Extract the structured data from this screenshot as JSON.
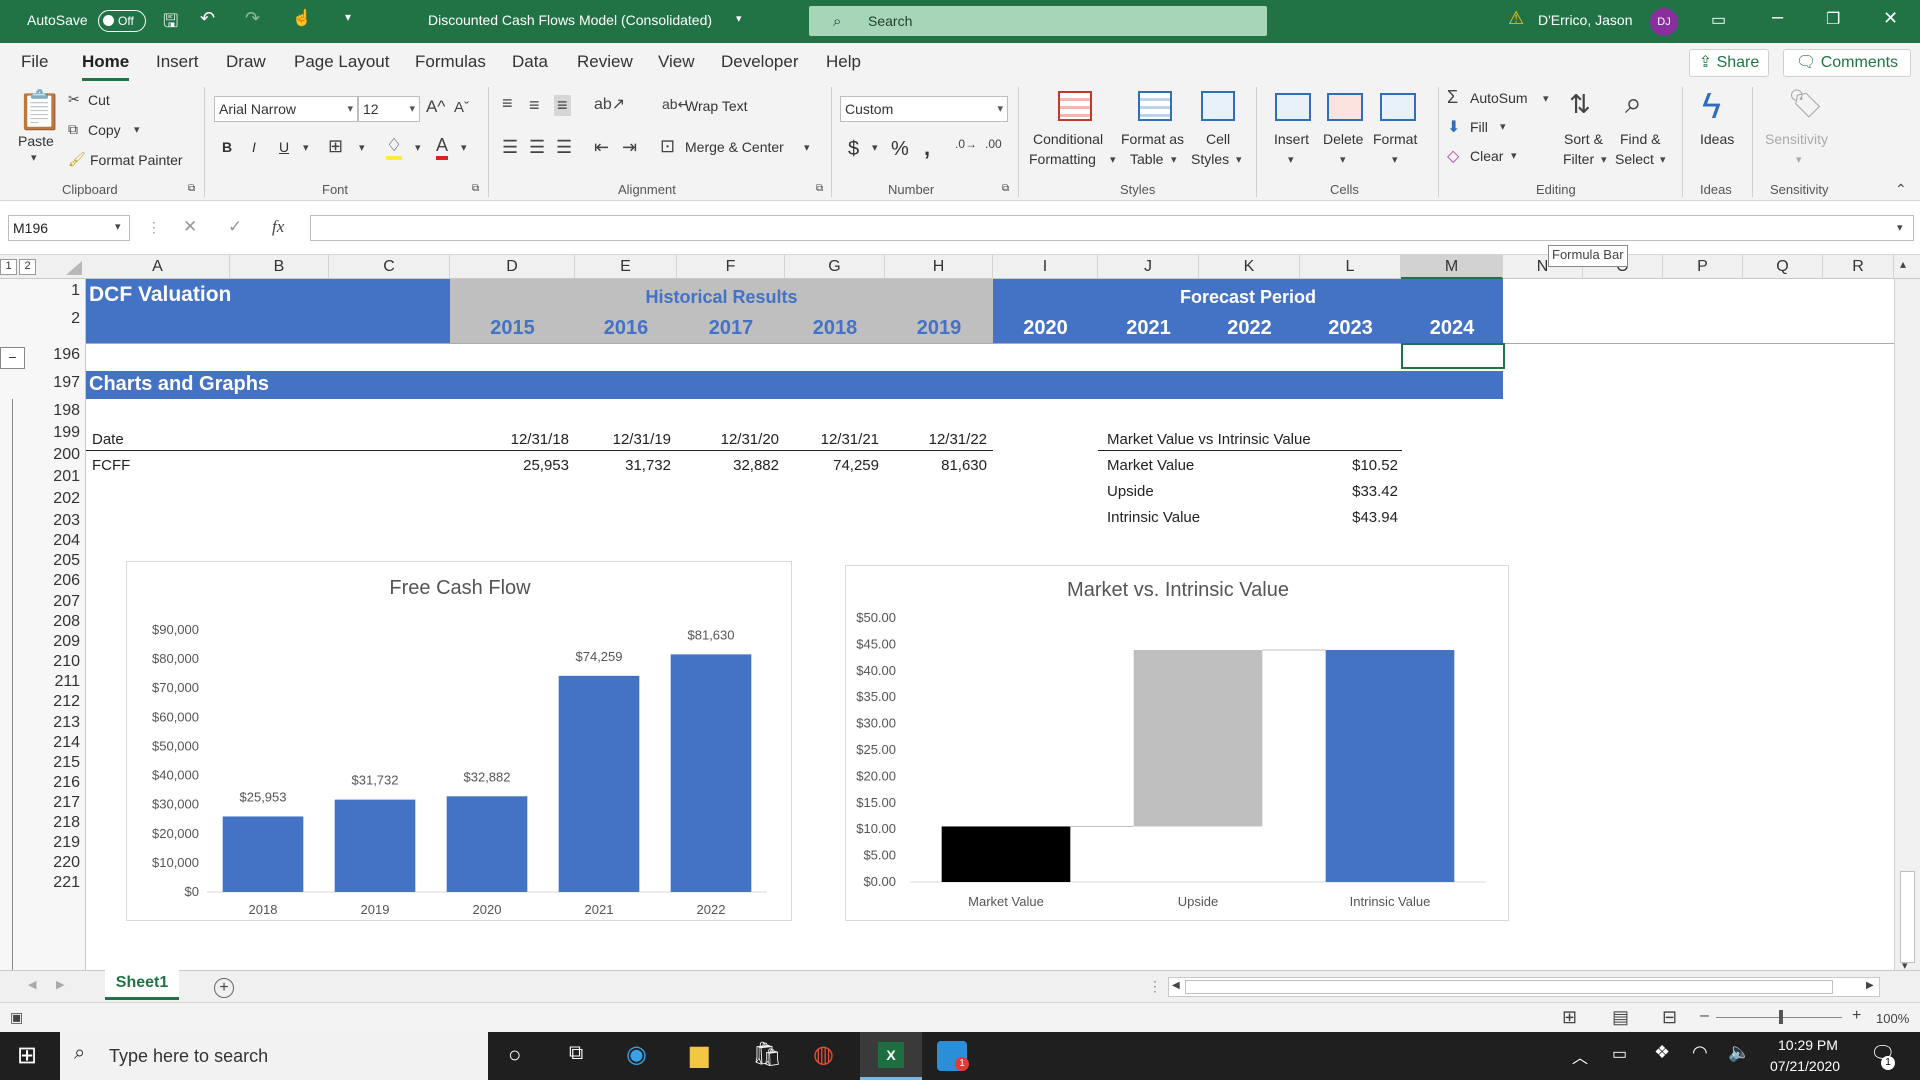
{
  "titlebar": {
    "autosave": "AutoSave",
    "autosave_state": "Off",
    "doc_title": "Discounted Cash Flows Model (Consolidated)",
    "search_placeholder": "Search",
    "user_name": "D'Errico, Jason",
    "user_initials": "DJ"
  },
  "ribbon_tabs": [
    "File",
    "Home",
    "Insert",
    "Draw",
    "Page Layout",
    "Formulas",
    "Data",
    "Review",
    "View",
    "Developer",
    "Help"
  ],
  "share_label": "Share",
  "comments_label": "Comments",
  "clipboard": {
    "paste": "Paste",
    "cut": "Cut",
    "copy": "Copy",
    "format_painter": "Format Painter",
    "group": "Clipboard"
  },
  "font": {
    "name": "Arial Narrow",
    "size": "12",
    "group": "Font",
    "bold": "B",
    "italic": "I",
    "underline": "U"
  },
  "alignment": {
    "wrap_text": "Wrap Text",
    "merge_center": "Merge & Center",
    "group": "Alignment"
  },
  "number": {
    "format": "Custom",
    "group": "Number",
    "dollar": "$",
    "percent": "%",
    "comma": ","
  },
  "styles": {
    "conditional": [
      "Conditional",
      "Formatting"
    ],
    "format_table": [
      "Format as",
      "Table"
    ],
    "cell_styles": [
      "Cell",
      "Styles"
    ],
    "group": "Styles"
  },
  "cells": {
    "insert": "Insert",
    "delete": "Delete",
    "format": "Format",
    "group": "Cells"
  },
  "editing": {
    "autosum": "AutoSum",
    "fill": "Fill",
    "clear": "Clear",
    "sort": [
      "Sort &",
      "Filter"
    ],
    "find": [
      "Find &",
      "Select"
    ],
    "group": "Editing"
  },
  "ideas": {
    "label": "Ideas",
    "group": "Ideas"
  },
  "sensitivity": {
    "label": "Sensitivity",
    "group": "Sensitivity"
  },
  "formula_bar": {
    "name_box": "M196",
    "fx": "fx",
    "tooltip": "Formula Bar",
    "value": ""
  },
  "outline_levels": [
    "1",
    "2"
  ],
  "columns": [
    "A",
    "B",
    "C",
    "D",
    "E",
    "F",
    "G",
    "H",
    "I",
    "J",
    "K",
    "L",
    "M",
    "N",
    "O",
    "P",
    "Q",
    "R"
  ],
  "rows": [
    "1",
    "2",
    "196",
    "197",
    "198",
    "199",
    "200",
    "201",
    "202",
    "203",
    "204",
    "205",
    "206",
    "207",
    "208",
    "209",
    "210",
    "211",
    "212",
    "213",
    "214",
    "215",
    "216",
    "217",
    "218",
    "219",
    "220",
    "221"
  ],
  "header": {
    "dcf": "DCF Valuation",
    "historical": "Historical Results",
    "forecast": "Forecast Period",
    "years": [
      "2015",
      "2016",
      "2017",
      "2018",
      "2019",
      "2020",
      "2021",
      "2022",
      "2023",
      "2024"
    ]
  },
  "section_title": "Charts and Graphs",
  "table": {
    "date_label": "Date",
    "fcff_label": "FCFF",
    "dates": [
      "12/31/18",
      "12/31/19",
      "12/31/20",
      "12/31/21",
      "12/31/22"
    ],
    "fcff": [
      "25,953",
      "31,732",
      "32,882",
      "74,259",
      "81,630"
    ]
  },
  "mv_table": {
    "title": "Market Value vs Intrinsic Value",
    "rows": [
      {
        "label": "Market Value",
        "value": "$10.52"
      },
      {
        "label": "Upside",
        "value": "$33.42"
      },
      {
        "label": "Intrinsic Value",
        "value": "$43.94"
      }
    ]
  },
  "chart_data": [
    {
      "type": "bar",
      "title": "Free Cash Flow",
      "categories": [
        "2018",
        "2019",
        "2020",
        "2021",
        "2022"
      ],
      "values": [
        25953,
        31732,
        32882,
        74259,
        81630
      ],
      "data_labels": [
        "$25,953",
        "$31,732",
        "$32,882",
        "$74,259",
        "$81,630"
      ],
      "ylim": [
        0,
        90000
      ],
      "yticks": [
        "$0",
        "$10,000",
        "$20,000",
        "$30,000",
        "$40,000",
        "$50,000",
        "$60,000",
        "$70,000",
        "$80,000",
        "$90,000"
      ],
      "color": "#4472c4"
    },
    {
      "type": "bar",
      "subtype": "waterfall",
      "title": "Market vs. Intrinsic Value",
      "categories": [
        "Market Value",
        "Upside",
        "Intrinsic Value"
      ],
      "base": [
        0,
        10.52,
        0
      ],
      "values": [
        10.52,
        33.42,
        43.94
      ],
      "colors": [
        "#000000",
        "#bfbfbf",
        "#4472c4"
      ],
      "ylim": [
        0,
        50
      ],
      "yticks": [
        "$0.00",
        "$5.00",
        "$10.00",
        "$15.00",
        "$20.00",
        "$25.00",
        "$30.00",
        "$35.00",
        "$40.00",
        "$45.00",
        "$50.00"
      ]
    }
  ],
  "sheet_tab": "Sheet1",
  "zoom": "100%",
  "taskbar": {
    "search_placeholder": "Type here to search",
    "time": "10:29 PM",
    "date": "07/21/2020",
    "notifications": "1"
  },
  "colors": {
    "excel_green": "#217346",
    "header_blue": "#4472c4",
    "header_gray": "#bfbfbf"
  }
}
